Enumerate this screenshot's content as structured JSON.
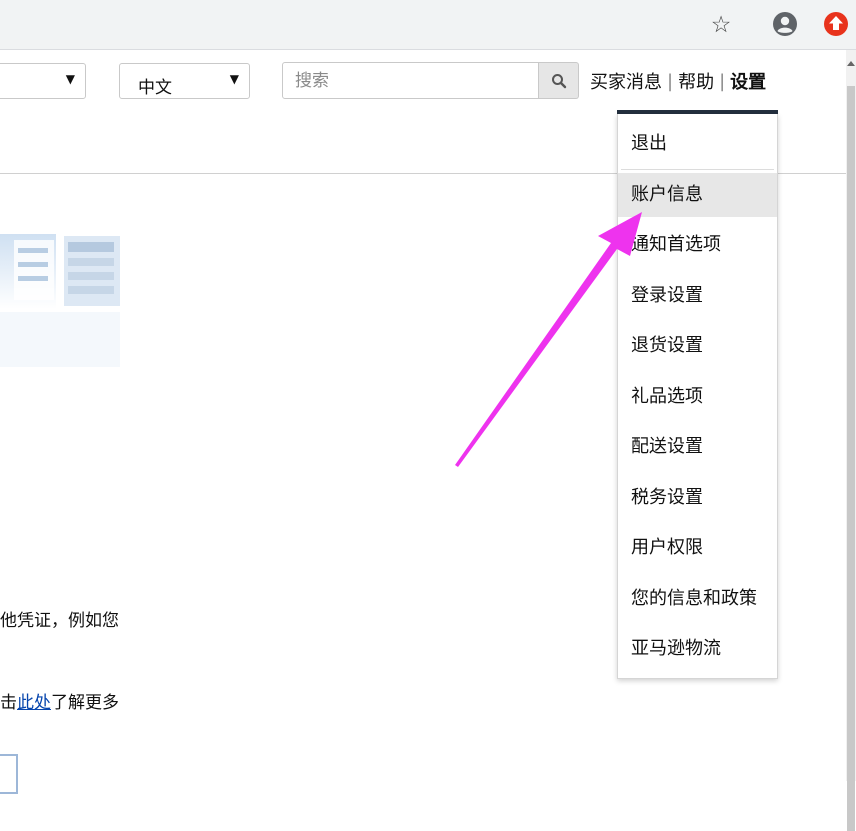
{
  "browser": {
    "star_icon": "☆",
    "icons": [
      "star-icon",
      "account-icon",
      "extension-icon"
    ]
  },
  "header": {
    "language_select": {
      "value": "中文",
      "arrow": "▼"
    },
    "left_select": {
      "arrow": "▼"
    },
    "search": {
      "placeholder": "搜索",
      "value": ""
    },
    "links": [
      {
        "label": "买家消息"
      },
      {
        "label": "帮助"
      },
      {
        "label": "设置"
      }
    ],
    "separator": "|"
  },
  "settings_menu": {
    "items": [
      {
        "label": "退出"
      },
      {
        "label": "账户信息"
      },
      {
        "label": "通知首选项"
      },
      {
        "label": "登录设置"
      },
      {
        "label": "退货设置"
      },
      {
        "label": "礼品选项"
      },
      {
        "label": "配送设置"
      },
      {
        "label": "税务设置"
      },
      {
        "label": "用户权限"
      },
      {
        "label": "您的信息和政策"
      },
      {
        "label": "亚马逊物流"
      }
    ],
    "highlighted": "账户信息"
  },
  "body": {
    "line1": "他凭证，例如您",
    "line2_prefix": "击",
    "line2_link": "此处",
    "line2_suffix": "了解更多"
  },
  "colors": {
    "annotation_arrow": "#ee33ee",
    "menu_hover": "#e7e7e7",
    "link": "#0645ad",
    "settings_underline": "#232f3e"
  }
}
